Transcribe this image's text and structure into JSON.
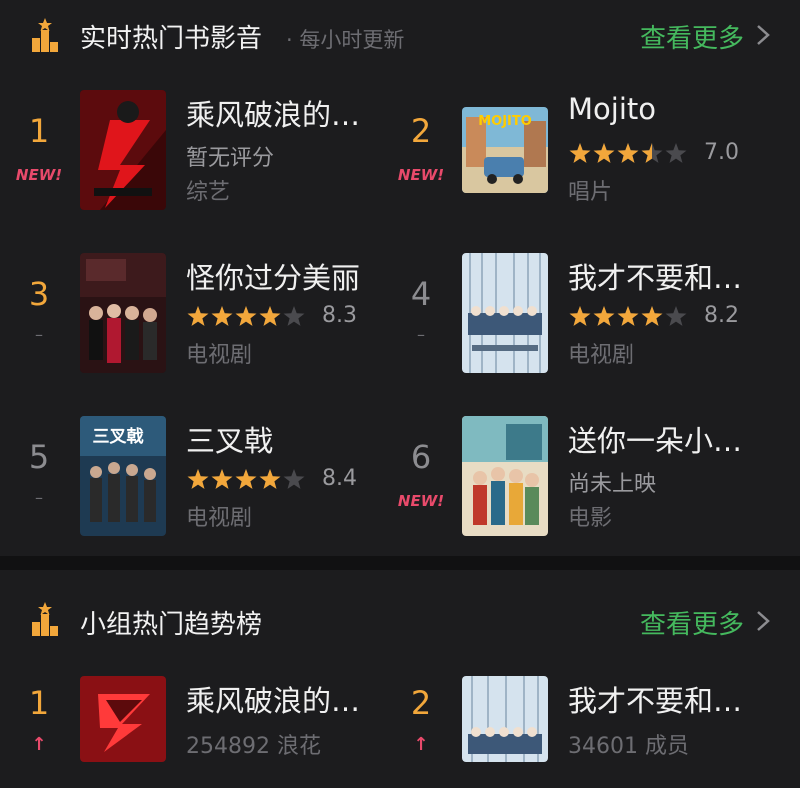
{
  "section1": {
    "title": "实时热门书影音",
    "subtitle": "· 每小时更新",
    "more": "查看更多",
    "items": [
      {
        "rank": "1",
        "tag": "NEW!",
        "title": "乘风破浪的…",
        "rating_text": "暂无评分",
        "category": "综艺",
        "stars": null,
        "score": ""
      },
      {
        "rank": "2",
        "tag": "NEW!",
        "title": "Mojito",
        "rating_text": "",
        "category": "唱片",
        "stars": 3.5,
        "score": "7.0"
      },
      {
        "rank": "3",
        "tag": "–",
        "title": "怪你过分美丽",
        "rating_text": "",
        "category": "电视剧",
        "stars": 4,
        "score": "8.3"
      },
      {
        "rank": "4",
        "tag": "–",
        "title": "我才不要和…",
        "rating_text": "",
        "category": "电视剧",
        "stars": 4,
        "score": "8.2"
      },
      {
        "rank": "5",
        "tag": "–",
        "title": "三叉戟",
        "rating_text": "",
        "category": "电视剧",
        "stars": 4,
        "score": "8.4"
      },
      {
        "rank": "6",
        "tag": "NEW!",
        "title": "送你一朵小…",
        "rating_text": "尚未上映",
        "category": "电影",
        "stars": null,
        "score": ""
      }
    ]
  },
  "section2": {
    "title": "小组热门趋势榜",
    "more": "查看更多",
    "items": [
      {
        "rank": "1",
        "trend": "↑",
        "title": "乘风破浪的…",
        "sub": "254892 浪花"
      },
      {
        "rank": "2",
        "trend": "↑",
        "title": "我才不要和…",
        "sub": "34601 成员"
      }
    ]
  },
  "poster_labels": {
    "mojito": "MOJITO",
    "sanchaji": "三叉戟"
  },
  "colors": {
    "accent_rank": "#f2a73b",
    "new_tag": "#e84a6b",
    "more_link": "#45b95e",
    "star": "#f2a73b"
  },
  "icons": [
    "trophy-icon",
    "chevron-right-icon",
    "star-icon",
    "trend-up-icon"
  ]
}
